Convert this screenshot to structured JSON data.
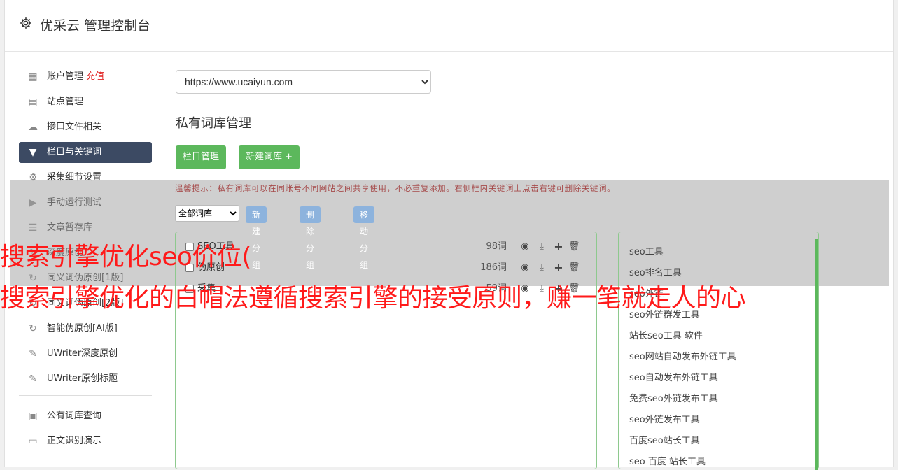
{
  "header": {
    "title": "优采云 管理控制台"
  },
  "sidebar": {
    "items": [
      {
        "label": "账户管理",
        "tag": "充值",
        "icon": "bar-chart-icon"
      },
      {
        "label": "站点管理",
        "icon": "server-icon"
      },
      {
        "label": "接口文件相关",
        "icon": "cloud-upload-icon"
      },
      {
        "label": "栏目与关键词",
        "icon": "filter-icon",
        "active": true
      },
      {
        "label": "采集细节设置",
        "icon": "gears-icon"
      },
      {
        "label": "手动运行测试",
        "icon": "play-circle-icon"
      },
      {
        "label": "文章暂存库",
        "icon": "database-icon"
      },
      {
        "label": "深度原创",
        "icon": "edit-icon"
      },
      {
        "label": "同义词伪原创[1版]",
        "icon": "refresh-icon"
      },
      {
        "label": "同义词伪原创[2版]",
        "icon": "refresh-icon"
      },
      {
        "label": "智能伪原创[AI版]",
        "icon": "refresh-icon"
      },
      {
        "label": "UWriter深度原创",
        "icon": "edit-icon"
      },
      {
        "label": "UWriter原创标题",
        "icon": "edit-icon"
      }
    ],
    "items2": [
      {
        "label": "公有词库查询",
        "icon": "book-icon"
      },
      {
        "label": "正文识别演示",
        "icon": "monitor-icon"
      }
    ]
  },
  "main": {
    "site_select": "https://www.ucaiyun.com",
    "section_title": "私有词库管理",
    "btn_column": "栏目管理",
    "btn_new_lib": "新建词库 +",
    "tip": "温馨提示：私有词库可以在同账号不同网站之间共享使用，不必重复添加。右侧框内关键词上点击右键可删除关键词。",
    "filter_select": "全部词库",
    "btn_new_group": "新建分组",
    "btn_delete_group": "删除分组",
    "btn_move_group": "移动分组"
  },
  "groups": [
    {
      "name": "SEO工具",
      "count": "98词"
    },
    {
      "name": "伪原创",
      "count": "186词"
    },
    {
      "name": "采集",
      "count": "59词"
    }
  ],
  "keywords": [
    "seo工具",
    "seo排名工具",
    "seo外链",
    "seo外链群发工具",
    "站长seo工具 软件",
    "seo网站自动发布外链工具",
    "seo自动发布外链工具",
    "免费seo外链发布工具",
    "seo外链发布工具",
    "百度seo站长工具",
    "seo 百度 站长工具"
  ],
  "watermark": {
    "line1": "搜索引擎优化seo价位(",
    "line2": "搜索引擎优化的白帽法遵循搜索引擎的接受原则，赚一笔就走人的心"
  },
  "colors": {
    "accent_green": "#5cb85c",
    "nav_active": "#3c4a63",
    "watermark": "#ff1a1a",
    "recharge": "#e02020"
  }
}
